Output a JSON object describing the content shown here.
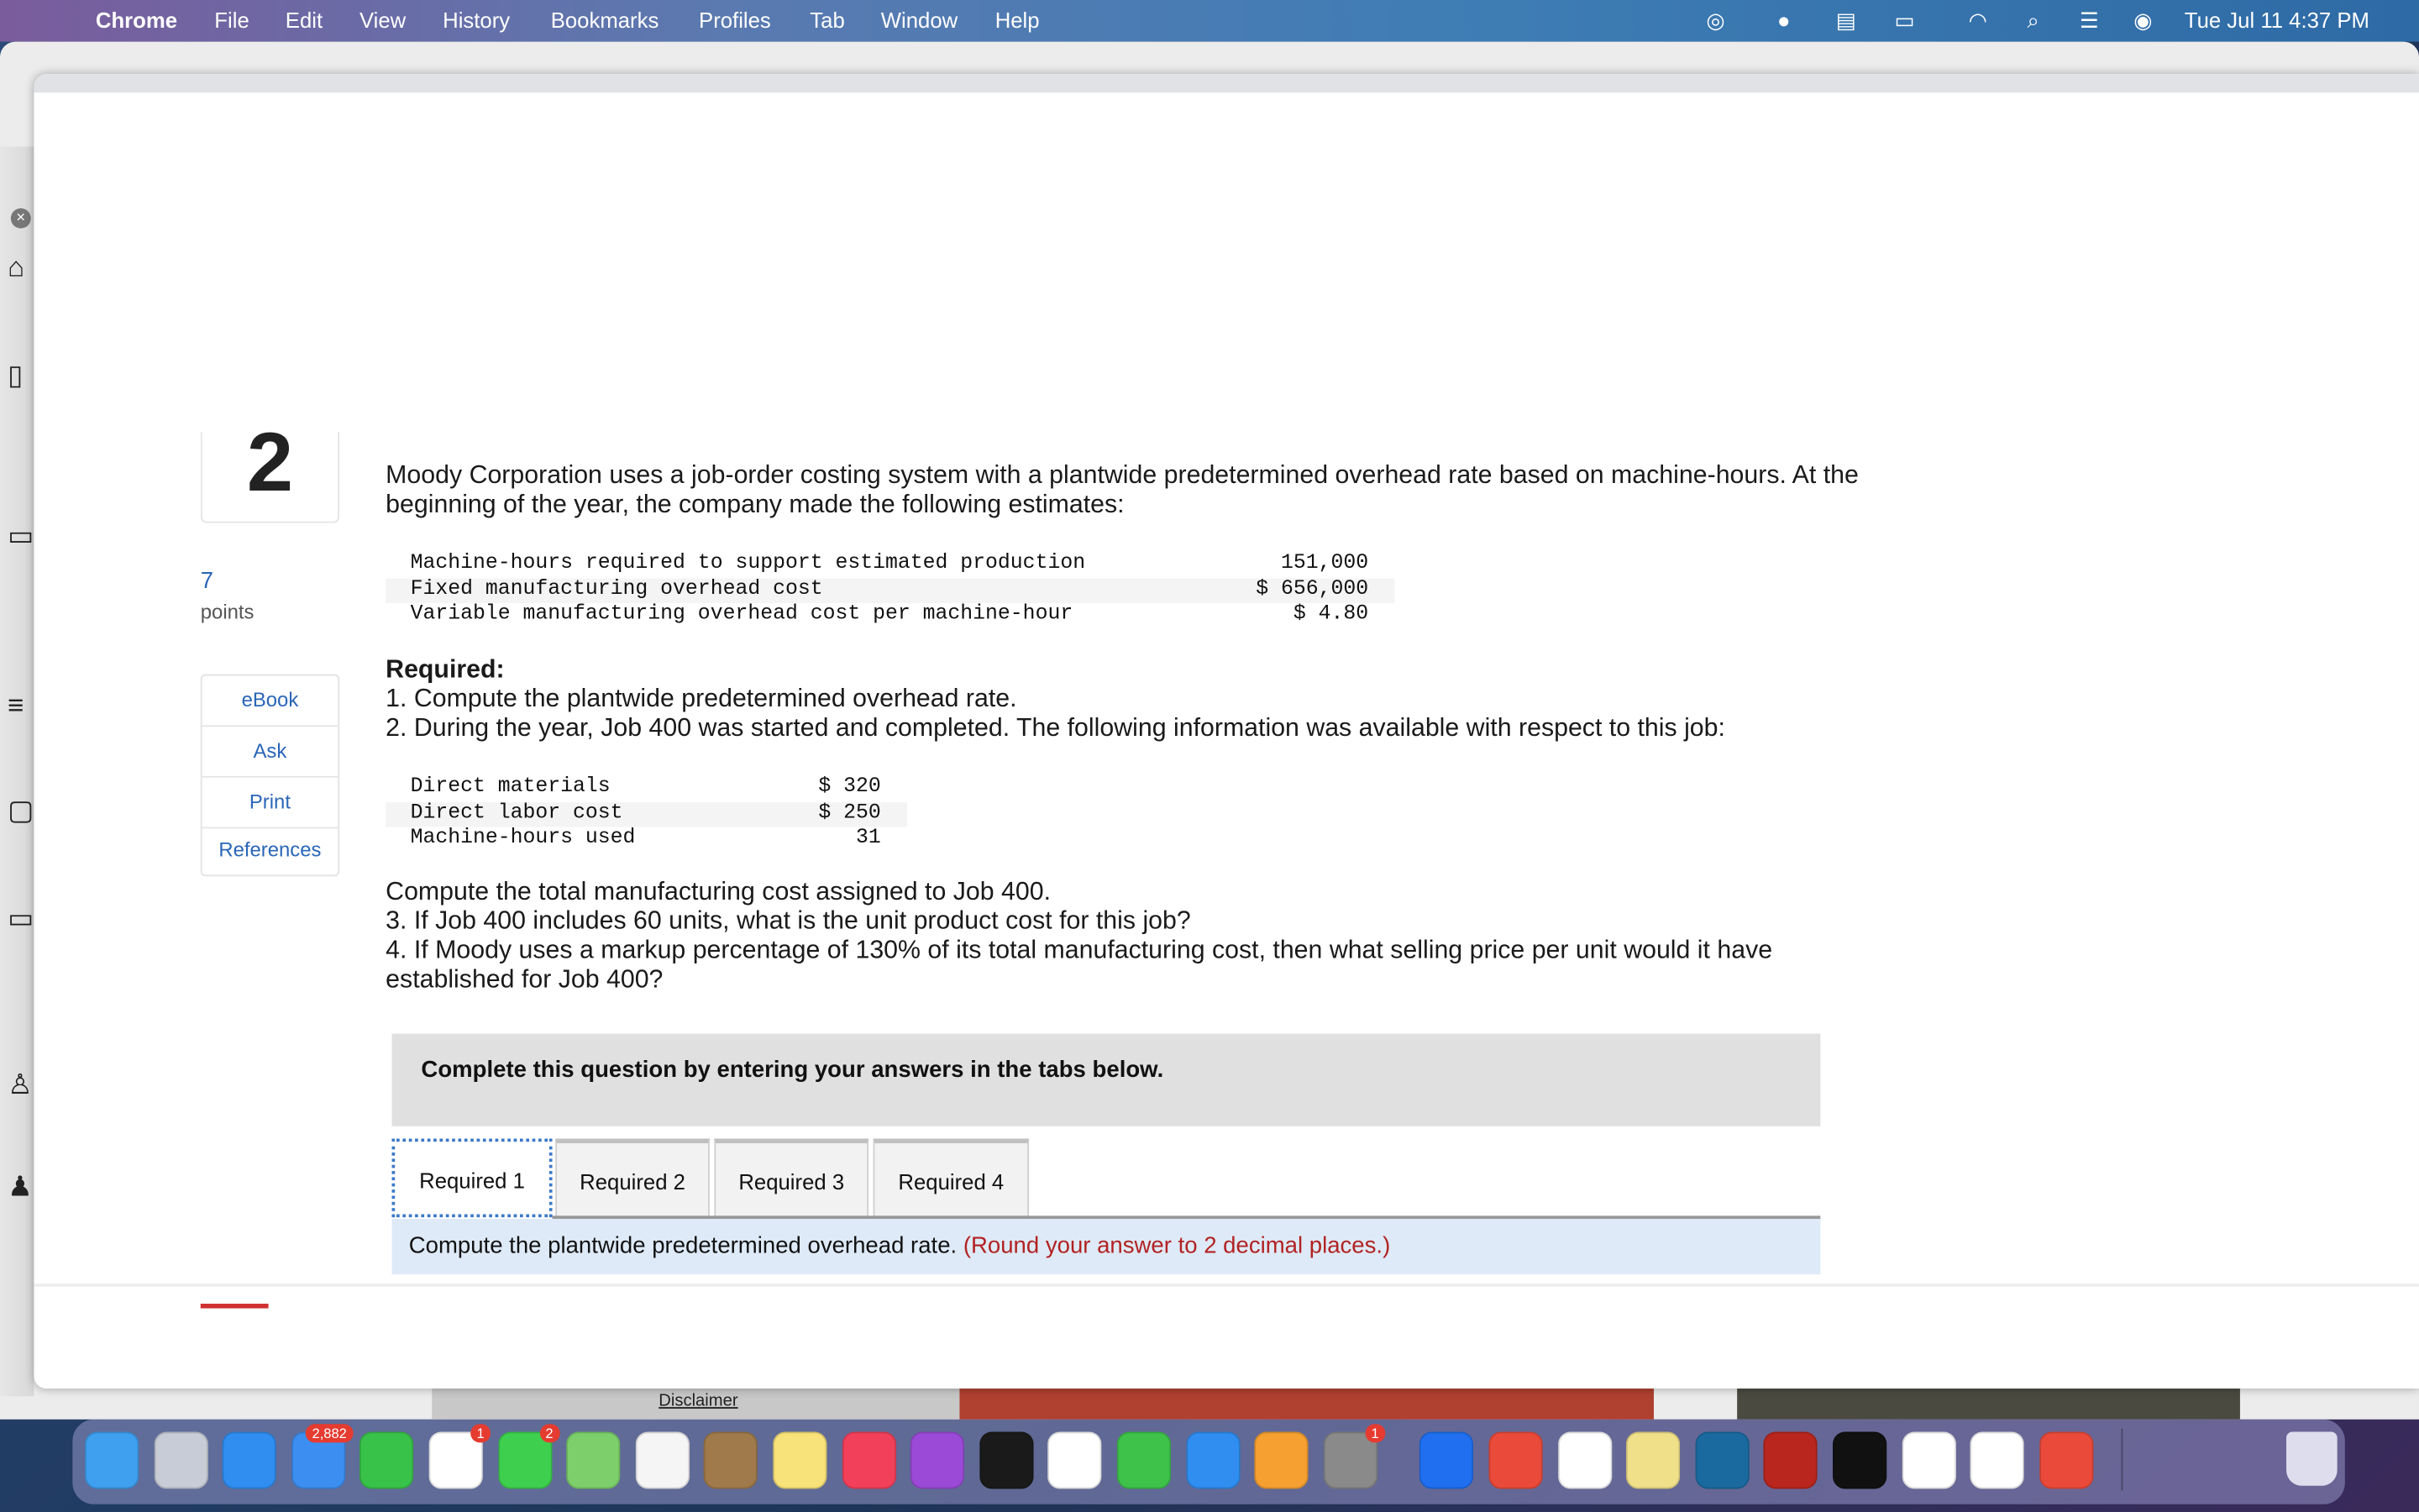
{
  "menubar": {
    "app": "Chrome",
    "items": [
      "File",
      "Edit",
      "View",
      "History",
      "Bookmarks",
      "Profiles",
      "Tab",
      "Window",
      "Help"
    ],
    "clock": "Tue Jul 11  4:37 PM"
  },
  "question": {
    "number": "2",
    "points_value": "7",
    "points_label": "points",
    "side_buttons": [
      "eBook",
      "Ask",
      "Print",
      "References"
    ],
    "intro_line1": "Moody Corporation uses a job-order costing system with a plantwide predetermined overhead rate based on machine-hours. At the",
    "intro_line2": "beginning of the year, the company made the following estimates:",
    "estimates": [
      {
        "label": "Machine-hours required to support estimated production",
        "value": "151,000"
      },
      {
        "label": "Fixed manufacturing overhead cost",
        "value": "$ 656,000"
      },
      {
        "label": "Variable manufacturing overhead cost per machine-hour",
        "value": "$ 4.80"
      }
    ],
    "required_heading": "Required:",
    "req1": "1. Compute the plantwide predetermined overhead rate.",
    "req2": "2. During the year, Job 400 was started and completed. The following information was available with respect to this job:",
    "job": [
      {
        "label": "Direct materials",
        "value": "$ 320"
      },
      {
        "label": "Direct labor cost",
        "value": "$ 250"
      },
      {
        "label": "Machine-hours used",
        "value": "31"
      }
    ],
    "p1": "Compute the total manufacturing cost assigned to Job 400.",
    "p2": "3. If Job 400 includes 60 units, what is the unit product cost for this job?",
    "p3": "4. If Moody uses a markup percentage of 130% of its total manufacturing cost, then what selling price per unit would it have",
    "p4": "established for Job 400?",
    "instruction_box": "Complete this question by entering your answers in the tabs below.",
    "tabs": [
      "Required 1",
      "Required 2",
      "Required 3",
      "Required 4"
    ],
    "active_tab": "Required 1",
    "tab_prompt": "Compute the plantwide predetermined overhead rate.",
    "tab_hint": "(Round your answer to 2 decimal places.)"
  },
  "background": {
    "disclaimer": "Disclaimer"
  },
  "dock": {
    "apps": [
      {
        "name": "finder",
        "color": "#3fa0f0"
      },
      {
        "name": "launchpad",
        "color": "#c8ccd6"
      },
      {
        "name": "safari",
        "color": "#2f8ef0"
      },
      {
        "name": "mail",
        "color": "#3c8ff0",
        "badge": "2,882"
      },
      {
        "name": "facetime",
        "color": "#39c24a"
      },
      {
        "name": "reminders",
        "color": "#ffffff",
        "badge": "1"
      },
      {
        "name": "messages",
        "color": "#3fcf4f",
        "badge": "2"
      },
      {
        "name": "maps",
        "color": "#7ccf6a"
      },
      {
        "name": "photos",
        "color": "#f5f5f5"
      },
      {
        "name": "contacts",
        "color": "#a07a4a"
      },
      {
        "name": "notes",
        "color": "#f8e27a"
      },
      {
        "name": "music",
        "color": "#f2405a"
      },
      {
        "name": "podcasts",
        "color": "#9a4ad6"
      },
      {
        "name": "tv",
        "color": "#1a1a1a"
      },
      {
        "name": "news",
        "color": "#ffffff"
      },
      {
        "name": "numbers",
        "color": "#3ec24a"
      },
      {
        "name": "keynote",
        "color": "#2f8ef0"
      },
      {
        "name": "pages",
        "color": "#f5a030"
      },
      {
        "name": "system-preferences",
        "color": "#8a8a8a",
        "badge": "1"
      },
      {
        "name": "zoom",
        "color": "#1f6ff0"
      },
      {
        "name": "anydesk",
        "color": "#ea4a3a"
      },
      {
        "name": "chrome",
        "color": "#ffffff"
      },
      {
        "name": "stickies",
        "color": "#f0e08a"
      },
      {
        "name": "edge-app",
        "color": "#1a6aa0"
      },
      {
        "name": "acrobat",
        "color": "#b8261e"
      },
      {
        "name": "terminal",
        "color": "#111111"
      },
      {
        "name": "excel",
        "color": "#ffffff"
      },
      {
        "name": "word",
        "color": "#ffffff"
      },
      {
        "name": "anydesk-2",
        "color": "#ea4a3a"
      }
    ]
  },
  "colors": {
    "link": "#2a66b8",
    "hint": "#b22222",
    "tab_panel": "#deeaf7",
    "instruction_bg": "#e0e0e0"
  }
}
